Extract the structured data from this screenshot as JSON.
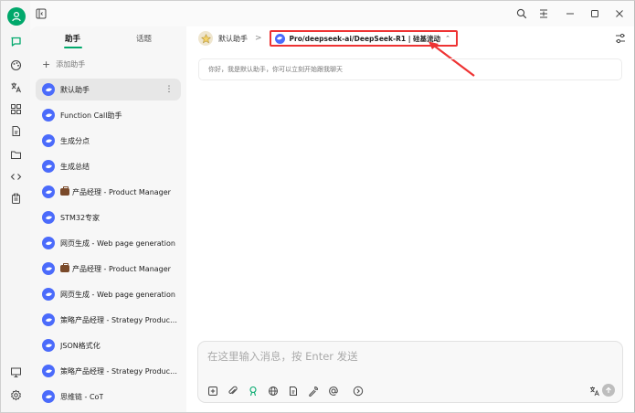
{
  "panel": {
    "tabs": [
      {
        "label": "助手",
        "active": true
      },
      {
        "label": "话题",
        "active": false
      }
    ],
    "add_label": "添加助手",
    "assistants": [
      {
        "label": "默认助手",
        "selected": true,
        "emoji": false
      },
      {
        "label": "Function Call助手",
        "selected": false,
        "emoji": false
      },
      {
        "label": "生成分点",
        "selected": false,
        "emoji": false
      },
      {
        "label": "生成总结",
        "selected": false,
        "emoji": false
      },
      {
        "label": "产品经理 - Product Manager",
        "selected": false,
        "emoji": true
      },
      {
        "label": "STM32专家",
        "selected": false,
        "emoji": false
      },
      {
        "label": "网页生成 - Web page generation",
        "selected": false,
        "emoji": false
      },
      {
        "label": "产品经理 - Product Manager",
        "selected": false,
        "emoji": true
      },
      {
        "label": "网页生成 - Web page generation",
        "selected": false,
        "emoji": false
      },
      {
        "label": "策略产品经理 - Strategy Product Manager",
        "selected": false,
        "emoji": false
      },
      {
        "label": "JSON格式化",
        "selected": false,
        "emoji": false
      },
      {
        "label": "策略产品经理 - Strategy Product Manager",
        "selected": false,
        "emoji": false
      },
      {
        "label": "思维链 - CoT",
        "selected": false,
        "emoji": false
      }
    ]
  },
  "chat": {
    "breadcrumb_assistant": "默认助手",
    "breadcrumb_separator": ">",
    "model_label": "Pro/deepseek-ai/DeepSeek-R1 | 硅基流动",
    "greeting": "你好，我是默认助手，你可以立刻开始跟我聊天",
    "input_placeholder": "在这里输入消息，按 Enter 发送"
  },
  "colors": {
    "accent": "#00a86b",
    "model_logo": "#4b6bfb",
    "highlight_border": "#ee3333"
  }
}
